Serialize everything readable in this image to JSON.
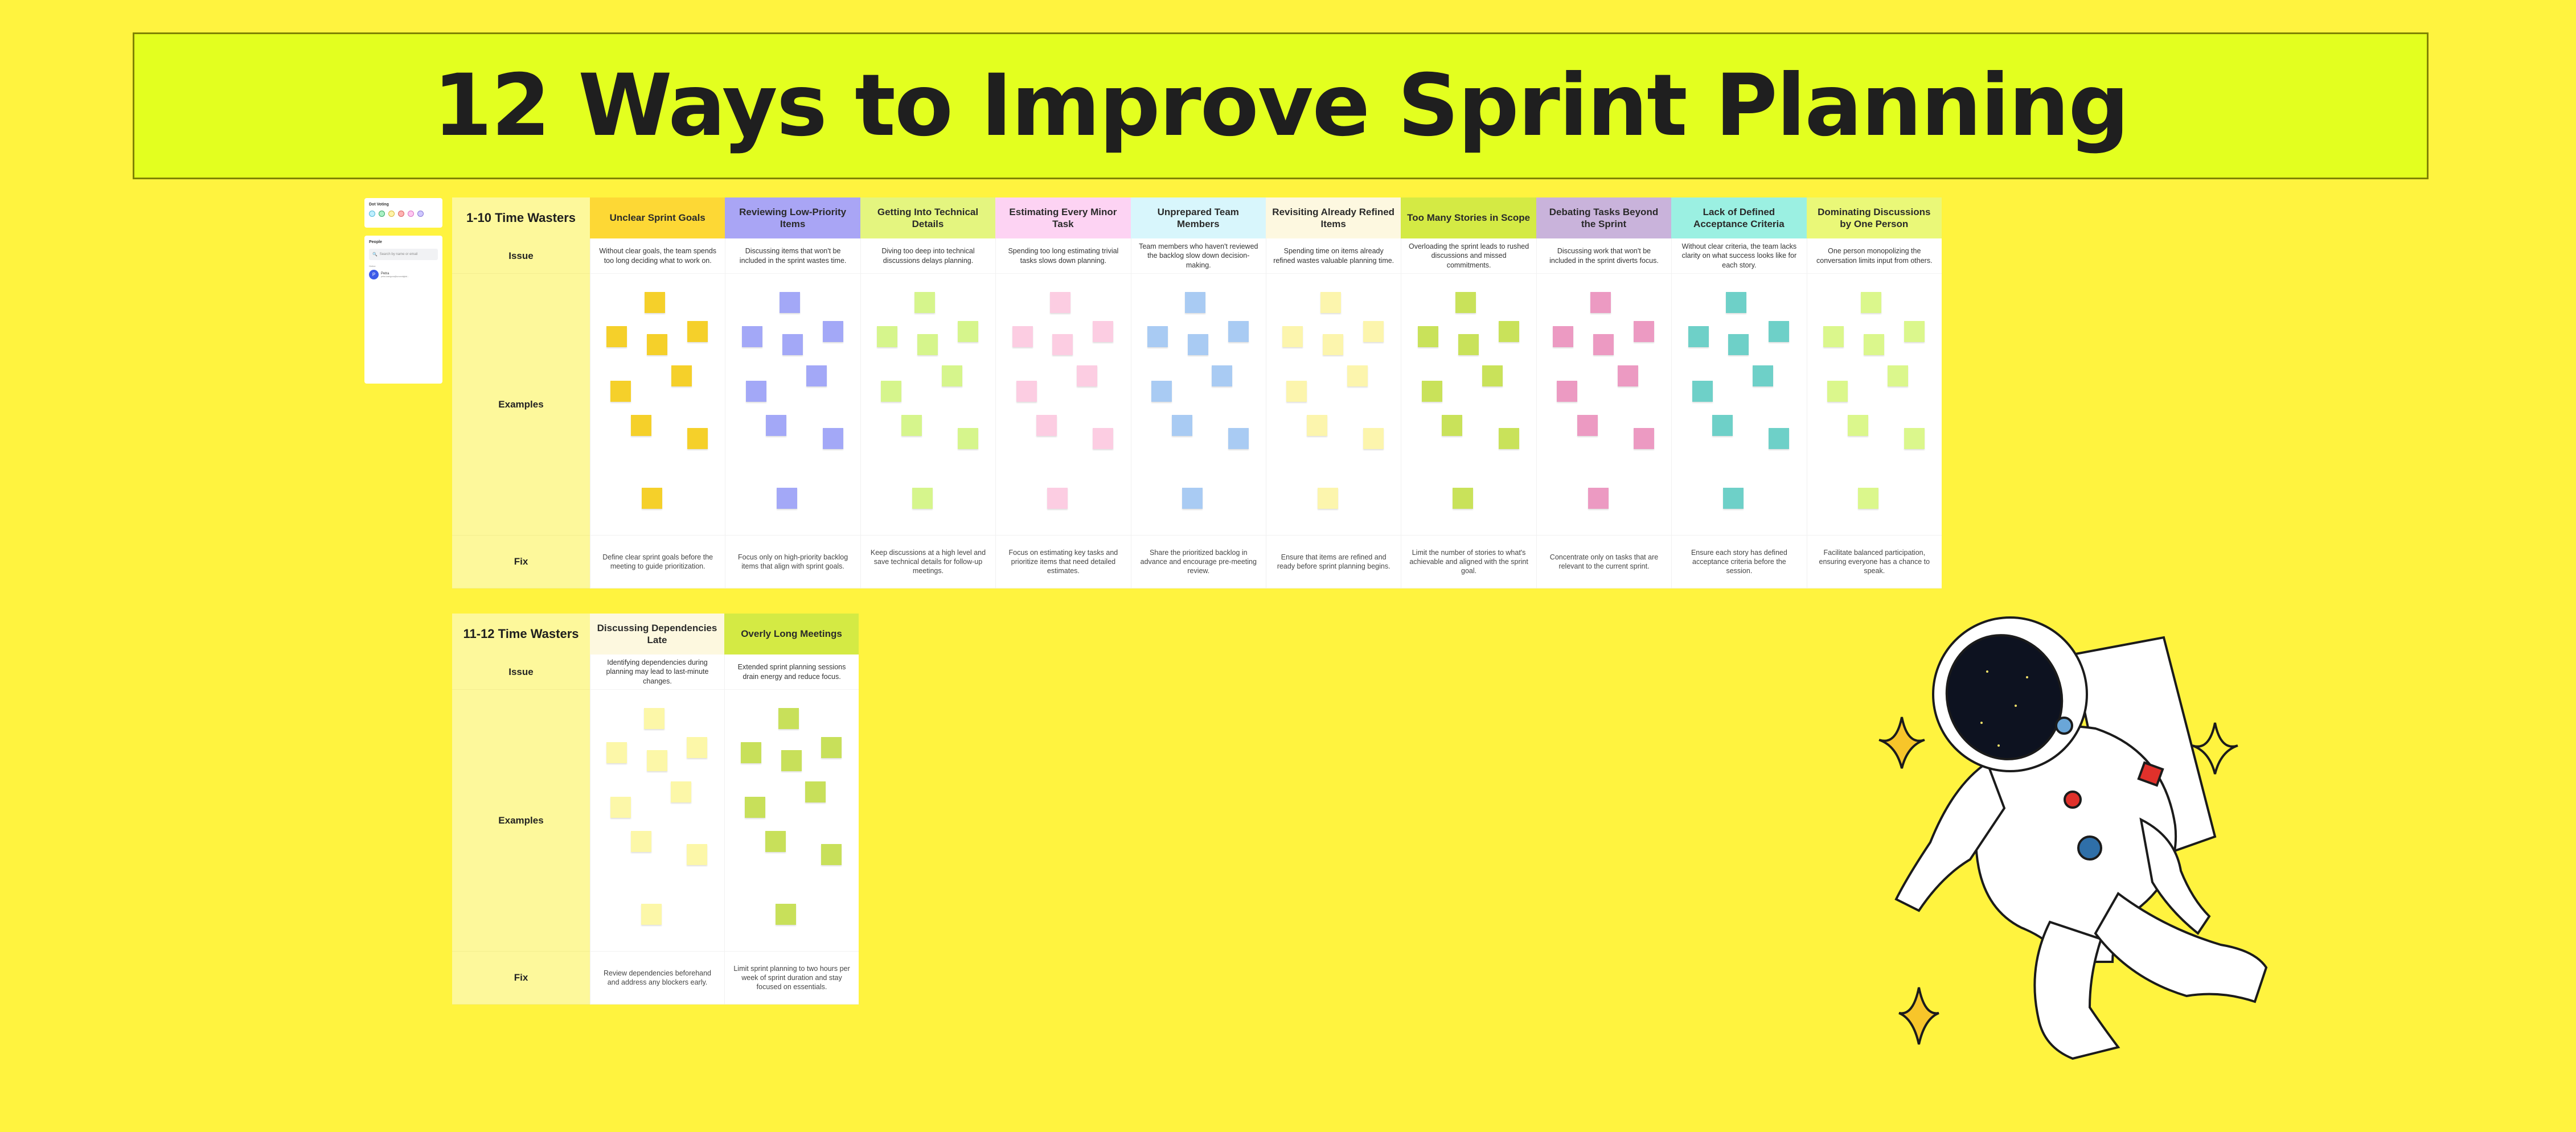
{
  "title": "12 Ways to Improve Sprint Planning",
  "dot_voting": {
    "title": "Dot Voting",
    "colors": [
      "#bfefff",
      "#a9f0c4",
      "#fff3a8",
      "#ffb3b3",
      "#ffc8f0",
      "#cfc8ff"
    ],
    "borders": [
      "#55b8d8",
      "#3aa86a",
      "#d8b640",
      "#d86262",
      "#d872c4",
      "#8a7ad8"
    ]
  },
  "people": {
    "title": "People",
    "search_placeholder": "Search by name or email",
    "section": "Online",
    "users": [
      {
        "initial": "P",
        "name": "Petra",
        "email": "petra.ivanigova@scrumdigital..."
      }
    ]
  },
  "row_labels": {
    "issue": "Issue",
    "examples": "Examples",
    "fix": "Fix"
  },
  "tables": [
    {
      "title": "1-10 Time Wasters",
      "columns": [
        {
          "name": "Unclear Sprint Goals",
          "header_color": "#fdd835",
          "sticky_color": "#f5d02a",
          "issue": "Without clear goals, the team spends too long deciding what to work on.",
          "fix": "Define clear sprint goals before the meeting to guide prioritization."
        },
        {
          "name": "Reviewing Low-Priority Items",
          "header_color": "#a9a5f5",
          "sticky_color": "#a3a8f7",
          "issue": "Discussing items that won't be included in the sprint wastes time.",
          "fix": "Focus only on high-priority backlog items that align with sprint goals."
        },
        {
          "name": "Getting Into Technical Details",
          "header_color": "#e4f57f",
          "sticky_color": "#d6f58c",
          "issue": "Diving too deep into technical discussions delays planning.",
          "fix": "Keep discussions at a high level and save technical details for follow-up meetings."
        },
        {
          "name": "Estimating Every Minor Task",
          "header_color": "#fdd3f3",
          "sticky_color": "#fccde2",
          "issue": "Spending too long estimating trivial tasks slows down planning.",
          "fix": "Focus on estimating key tasks and prioritize items that need detailed estimates."
        },
        {
          "name": "Unprepared Team Members",
          "header_color": "#d8f6fc",
          "sticky_color": "#a9cbf3",
          "issue": "Team members who haven't reviewed the backlog slow down decision-making.",
          "fix": "Share the prioritized backlog in advance and encourage pre-meeting review."
        },
        {
          "name": "Revisiting Already Refined Items",
          "header_color": "#fdf8e0",
          "sticky_color": "#fcf5ad",
          "issue": "Spending time on items already refined wastes valuable planning time.",
          "fix": "Ensure that items are refined and ready before sprint planning begins."
        },
        {
          "name": "Too Many Stories in Scope",
          "header_color": "#d4ea44",
          "sticky_color": "#c9e25a",
          "issue": "Overloading the sprint leads to rushed discussions and missed commitments.",
          "fix": "Limit the number of stories to what's achievable and aligned with the sprint goal."
        },
        {
          "name": "Debating Tasks Beyond the Sprint",
          "header_color": "#c9b3db",
          "sticky_color": "#ec9ac2",
          "issue": "Discussing work that won't be included in the sprint diverts focus.",
          "fix": "Concentrate only on tasks that are relevant to the current sprint."
        },
        {
          "name": "Lack of Defined Acceptance Criteria",
          "header_color": "#9bf0e2",
          "sticky_color": "#6ed0c8",
          "issue": "Without clear criteria, the team lacks clarity on what success looks like for each story.",
          "fix": "Ensure each story has defined acceptance criteria before the session."
        },
        {
          "name": "Dominating Discussions by One Person",
          "header_color": "#eaf878",
          "sticky_color": "#dbf78c",
          "issue": "One person monopolizing the conversation limits input from others.",
          "fix": "Facilitate balanced participation, ensuring everyone has a chance to speak."
        }
      ]
    },
    {
      "title": "11-12 Time Wasters",
      "columns": [
        {
          "name": "Discussing Dependencies Late",
          "header_color": "#fdf8df",
          "sticky_color": "#fcf7a8",
          "issue": "Identifying dependencies during planning may lead to last-minute changes.",
          "fix": "Review dependencies beforehand and address any blockers early."
        },
        {
          "name": "Overly Long Meetings",
          "header_color": "#d4ea44",
          "sticky_color": "#c8e05a",
          "issue": "Extended sprint planning sessions drain energy and reduce focus.",
          "fix": "Limit sprint planning to two hours per week of sprint duration and stay focused on essentials."
        }
      ]
    }
  ],
  "stickies_per_column": 10,
  "illustration": "astronaut-illustration"
}
